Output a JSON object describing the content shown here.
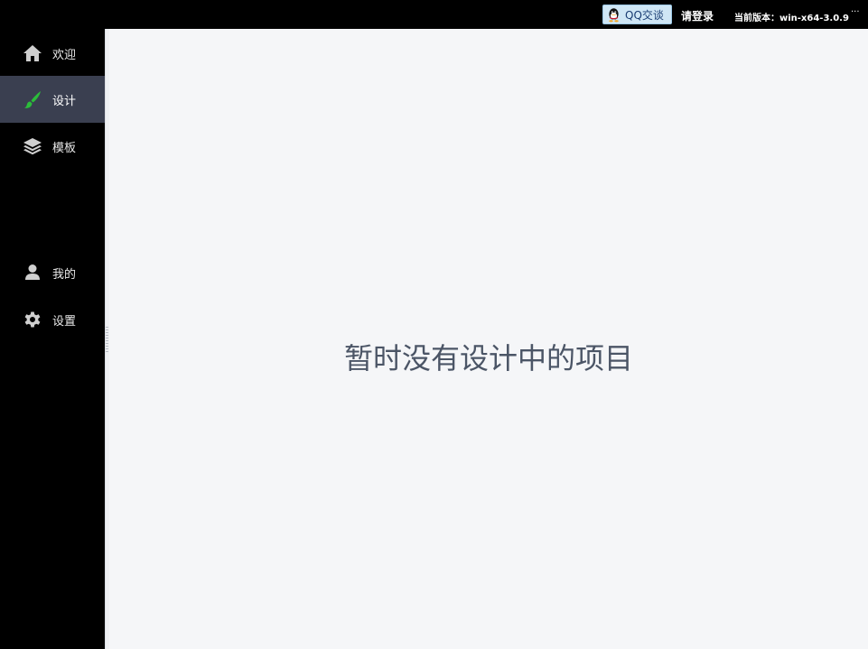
{
  "topbar": {
    "qq_label": "QQ交谈",
    "login_label": "请登录",
    "version_label": "当前版本：win-x64-3.0.9",
    "more_label": "···"
  },
  "sidebar": {
    "items": [
      {
        "label": "欢迎",
        "icon": "home-icon",
        "active": false
      },
      {
        "label": "设计",
        "icon": "brush-icon",
        "active": true
      },
      {
        "label": "模板",
        "icon": "layers-icon",
        "active": false
      },
      {
        "label": "我的",
        "icon": "user-icon",
        "active": false
      },
      {
        "label": "设置",
        "icon": "gear-icon",
        "active": false
      }
    ]
  },
  "main": {
    "empty_message": "暂时没有设计中的项目"
  },
  "colors": {
    "sidebar_bg": "#000000",
    "active_item_bg": "#3a3f50",
    "brush_accent": "#2bbd3a",
    "main_bg": "#f5f6f8",
    "qq_button_bg": "#cfe6f5"
  }
}
